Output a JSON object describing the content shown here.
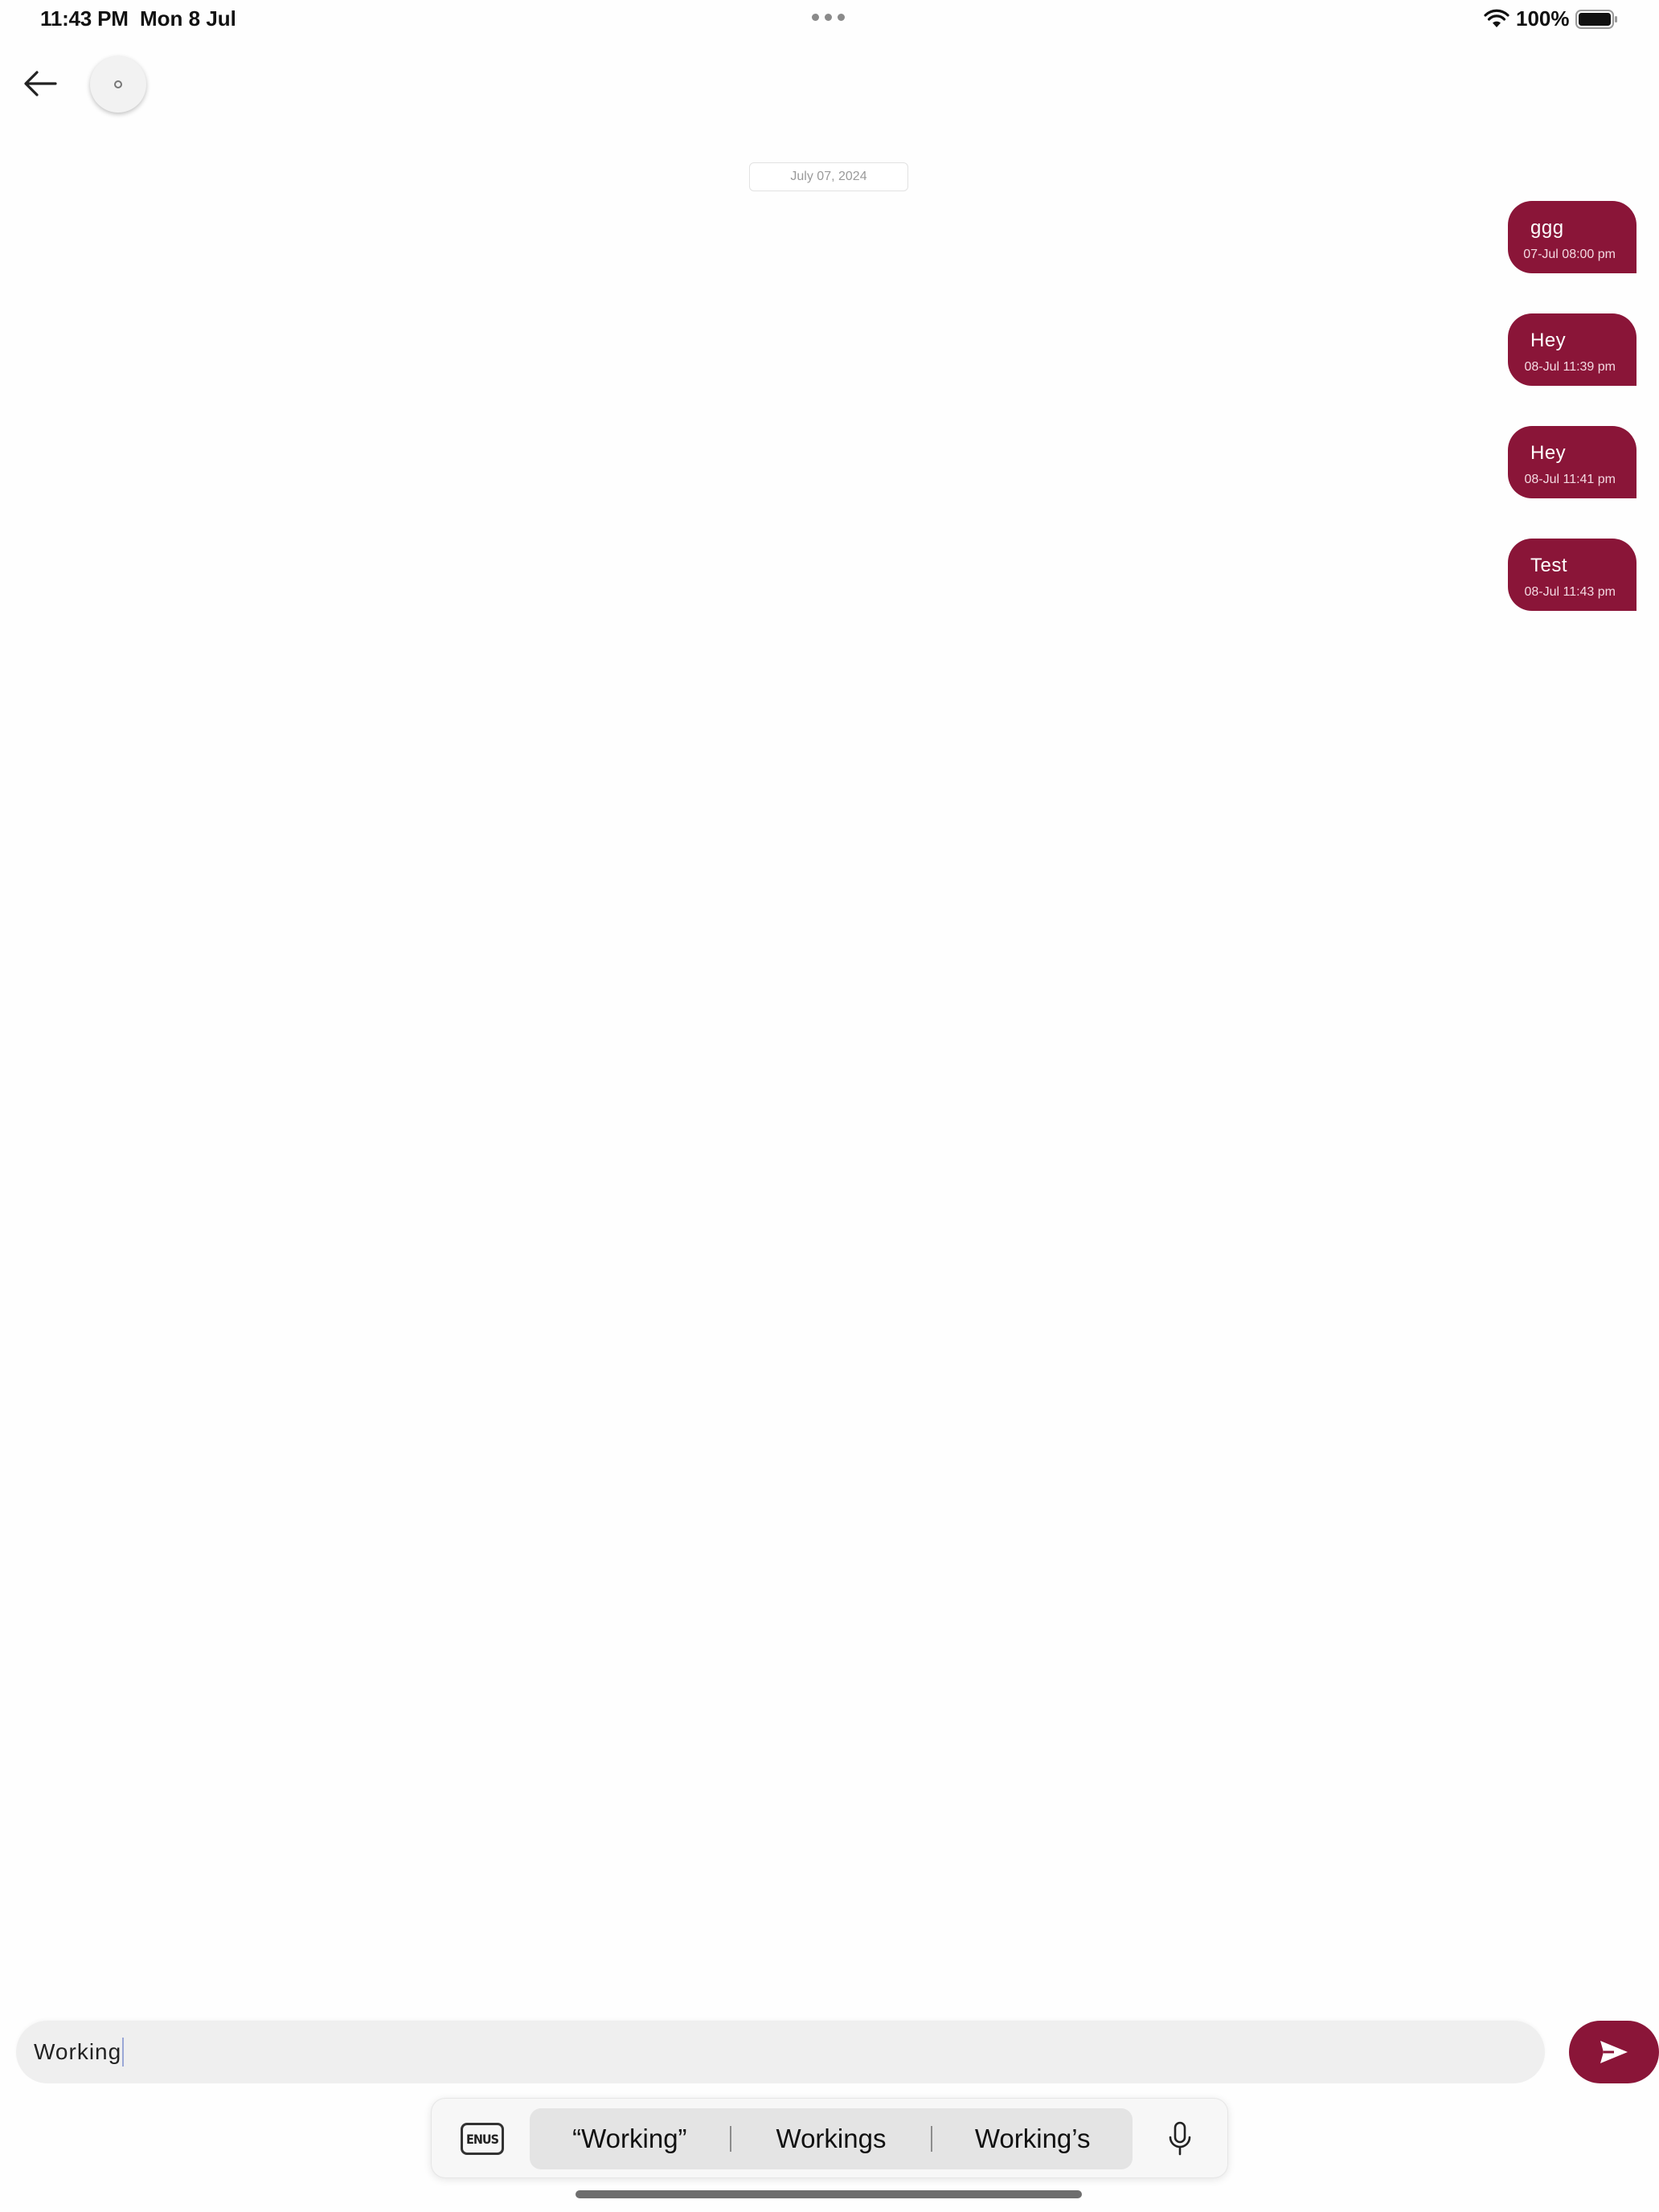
{
  "status_bar": {
    "time": "11:43 PM",
    "date": "Mon 8 Jul",
    "battery_percent": "100%",
    "icons": [
      "multitasking-dots-icon",
      "wifi-icon",
      "battery-icon"
    ]
  },
  "header": {
    "back_icon": "arrow-left-icon",
    "avatar_icon": "avatar-placeholder"
  },
  "conversation": {
    "date_chip": "July 07, 2024",
    "messages": [
      {
        "text": "ggg",
        "time": "07-Jul 08:00 pm",
        "direction": "outgoing"
      },
      {
        "text": "Hey",
        "time": "08-Jul 11:39 pm",
        "direction": "outgoing"
      },
      {
        "text": "Hey",
        "time": "08-Jul 11:41 pm",
        "direction": "outgoing"
      },
      {
        "text": "Test",
        "time": "08-Jul 11:43 pm",
        "direction": "outgoing"
      }
    ]
  },
  "composer": {
    "value": "Working",
    "send_icon": "send-icon"
  },
  "keyboard_bar": {
    "language_label": "ENUS",
    "suggestions": [
      "“Working”",
      "Workings",
      "Working’s"
    ],
    "mic_icon": "microphone-icon"
  },
  "colors": {
    "accent": "#8a1538",
    "background": "#fefefe",
    "input_bg": "#efefef"
  }
}
